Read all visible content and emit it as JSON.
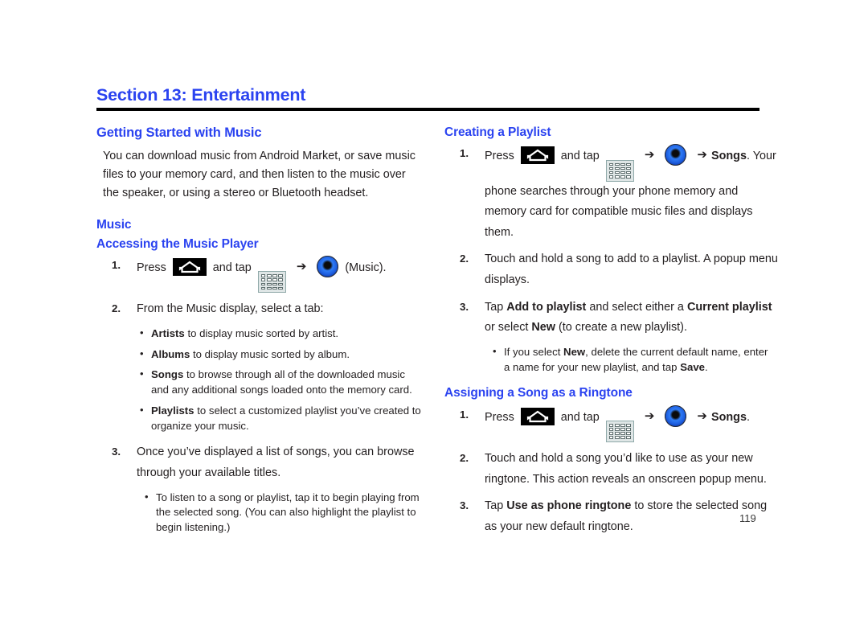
{
  "document": {
    "section_title": "Section 13: Entertainment",
    "page_number": "119",
    "accent_color": "#2b43f0",
    "text_color": "#231f20"
  },
  "icons": {
    "home": "home-key-icon",
    "apps": "apps-grid-icon",
    "music": "music-app-icon",
    "arrow": "➔"
  },
  "left_column": {
    "heading": "Getting Started with Music",
    "intro": "You can download music from Android Market, or save music files to your memory card, and then listen to the music over the speaker, or using a stereo or Bluetooth headset.",
    "subheading": "Music",
    "subsubheading": "Accessing the Music Player",
    "steps": [
      {
        "num": "1.",
        "pre": "Press",
        "mid": "and tap",
        "post": "(Music)."
      },
      {
        "num": "2.",
        "text": "From the Music display, select a tab:"
      },
      {
        "num": "3.",
        "text": "Once you’ve displayed a list of songs, you can browse through your available titles."
      }
    ],
    "tab_bullets": [
      {
        "bold": "Artists",
        "rest": " to display music sorted by artist."
      },
      {
        "bold": "Albums",
        "rest": " to display music sorted by album."
      },
      {
        "bold": "Songs",
        "rest": " to browse through all of the downloaded music and any additional songs loaded onto the memory card."
      },
      {
        "bold": "Playlists",
        "rest": " to select a customized playlist you’ve created to organize your music."
      }
    ],
    "listen_bullet": "To listen to a song or playlist, tap it to begin playing from the selected song. (You can also highlight the playlist to begin listening.)"
  },
  "right_column": {
    "heading_playlist": "Creating a Playlist",
    "playlist_steps": [
      {
        "num": "1.",
        "pre": "Press",
        "mid": "and tap",
        "songs": "Songs",
        "post": ". Your phone searches through your phone memory and memory card for compatible music files and displays them."
      },
      {
        "num": "2.",
        "text": "Touch and hold a song to add to a playlist. A popup menu displays."
      },
      {
        "num": "3.",
        "part1": "Tap ",
        "bold1": "Add to playlist",
        "part2": " and select either a ",
        "bold2": "Current playlist",
        "part3": " or select ",
        "bold3": "New",
        "part4": " (to create a new playlist)."
      }
    ],
    "playlist_note": {
      "part1": "If you select ",
      "bold1": "New",
      "part2": ", delete the current default name, enter a name for your new playlist, and tap ",
      "bold2": "Save",
      "part3": "."
    },
    "heading_ringtone": "Assigning a Song as a Ringtone",
    "ringtone_steps": [
      {
        "num": "1.",
        "pre": "Press",
        "mid": "and tap",
        "songs": "Songs",
        "post": "."
      },
      {
        "num": "2.",
        "text": "Touch and hold a song you’d like to use as your new ringtone. This action reveals an onscreen popup menu."
      },
      {
        "num": "3.",
        "part1": "Tap ",
        "bold1": "Use as phone ringtone",
        "part2": " to store the selected song as your new default ringtone."
      }
    ]
  }
}
